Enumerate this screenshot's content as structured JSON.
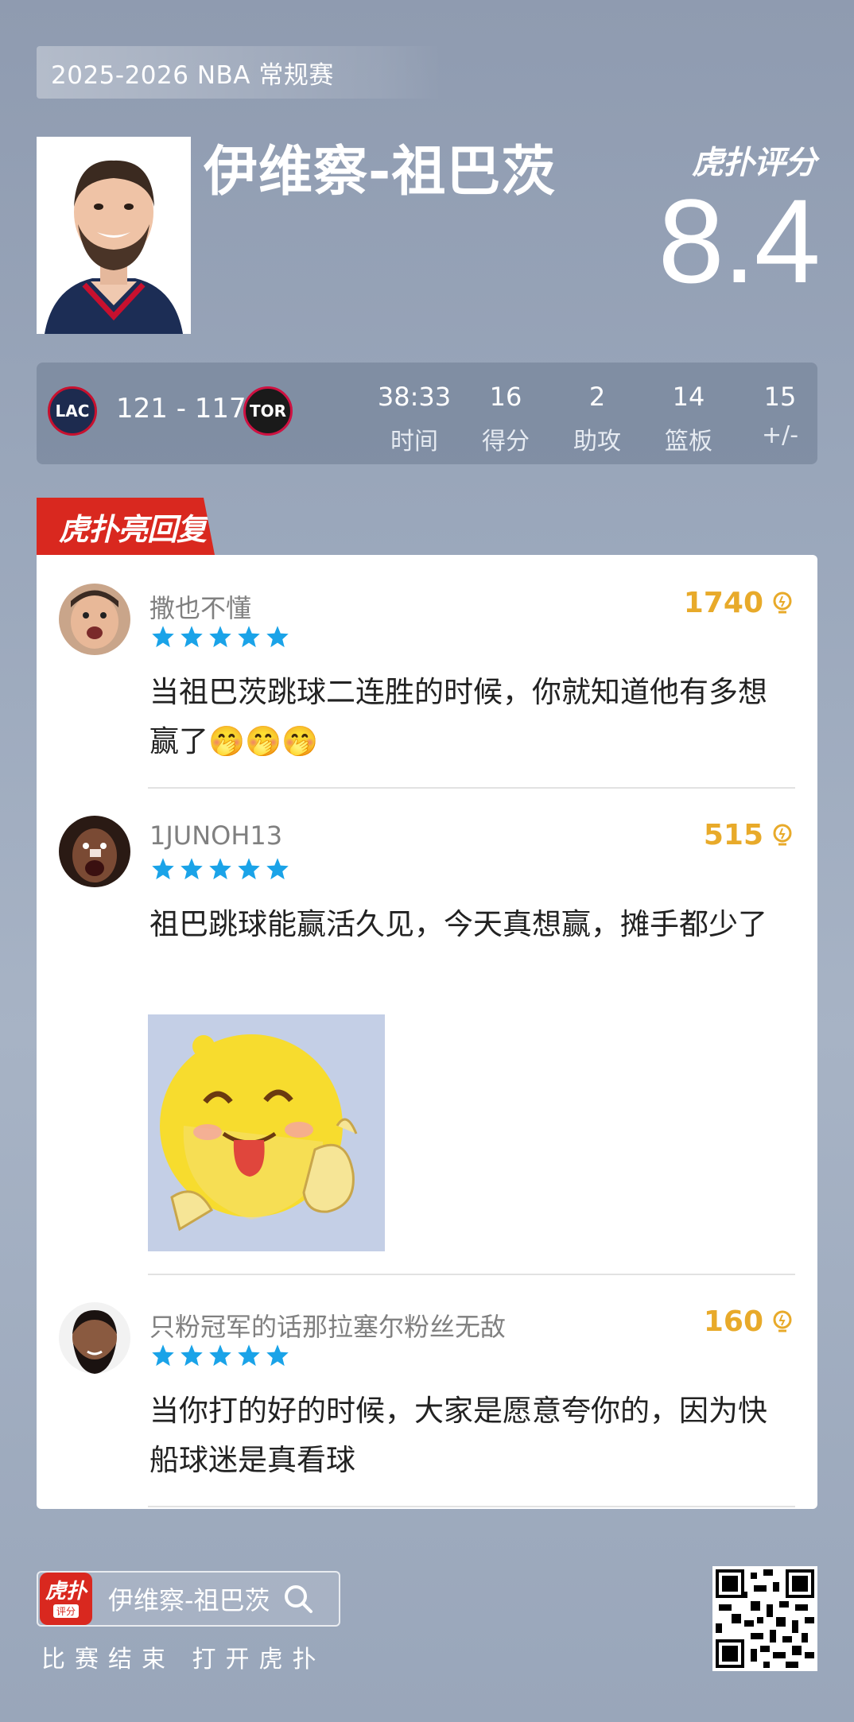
{
  "header": {
    "season": "2025-2026 NBA 常规赛",
    "player_name": "伊维察-祖巴茨",
    "brand": "虎扑评分",
    "rating": "8.4"
  },
  "game": {
    "home_team": "LAC",
    "away_team": "TOR",
    "score": "121 - 117",
    "stats": [
      {
        "value": "38:33",
        "label": "时间"
      },
      {
        "value": "16",
        "label": "得分"
      },
      {
        "value": "2",
        "label": "助攻"
      },
      {
        "value": "14",
        "label": "篮板"
      },
      {
        "value": "15",
        "label": "+/-"
      }
    ]
  },
  "section": {
    "title": "虎扑亮回复"
  },
  "comments": [
    {
      "username": "撒也不懂",
      "likes": "1740",
      "rating_stars": 5,
      "text": "当祖巴茨跳球二连胜的时候，你就知道他有多想赢了🤭🤭🤭"
    },
    {
      "username": "1JUNOH13",
      "likes": "515",
      "rating_stars": 5,
      "text": "祖巴跳球能赢活久见，今天真想赢，摊手都少了",
      "has_image": true
    },
    {
      "username": "只粉冠军的话那拉塞尔粉丝无敌",
      "likes": "160",
      "rating_stars": 5,
      "text": "当你打的好的时候，大家是愿意夸你的，因为快船球迷是真看球"
    }
  ],
  "footer": {
    "app_icon_main": "虎扑",
    "app_icon_sub": "评分",
    "search_text": "伊维察-祖巴茨",
    "caption": "比赛结束 打开虎扑"
  },
  "colors": {
    "brand_red": "#d9281f",
    "likes_gold": "#e8aa2a",
    "star_blue": "#1aa3e8"
  }
}
